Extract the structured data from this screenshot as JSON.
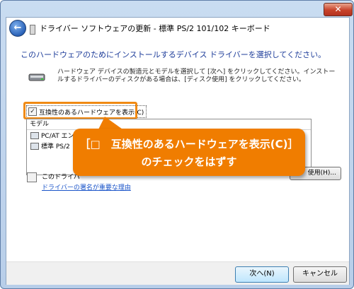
{
  "window": {
    "close_label": "✕",
    "title": "ドライバー ソフトウェアの更新 - 標準 PS/2 101/102 キーボード",
    "back_icon": "back-arrow-icon"
  },
  "heading": "このハードウェアのためにインストールするデバイス ドライバーを選択してください。",
  "instructions": "ハードウェア デバイスの製造元とモデルを選択して [次へ] をクリックしてください。インストールするドライバーのディスクがある場合は、[ディスク使用] をクリックしてください。",
  "compatible": {
    "label": "互換性のあるハードウェアを表示(C)",
    "checked_mark": "✓"
  },
  "list": {
    "header": "モデル",
    "items": [
      "PC/AT エン",
      "標準 PS/2"
    ]
  },
  "signed": {
    "text": "このドライバ",
    "link": "ドライバーの署名が重要な理由"
  },
  "disk_button": "使用(H)...",
  "footer": {
    "next": "次へ(N)",
    "cancel": "キャンセル"
  },
  "callout": {
    "line1": "［□　互換性のあるハードウェアを表示(C)］",
    "line2": "のチェックをはずす"
  },
  "colors": {
    "callout": "#f07d00",
    "highlight": "#f08a14",
    "heading": "#1e3d9a",
    "link": "#1a54c9"
  }
}
